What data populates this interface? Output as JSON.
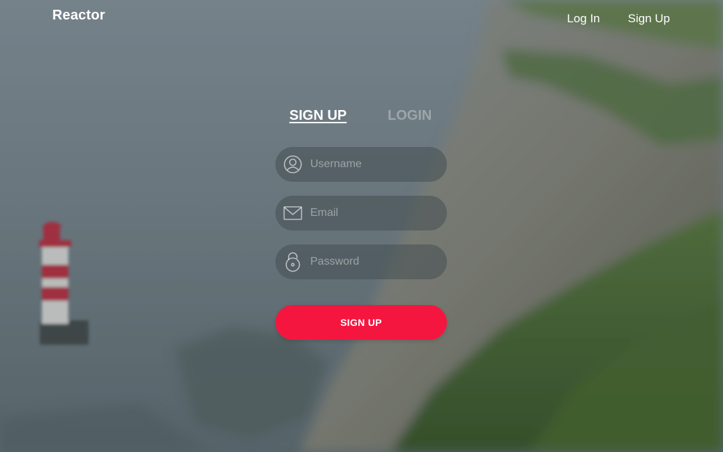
{
  "brand": {
    "name": "Reactor"
  },
  "nav": {
    "login_label": "Log In",
    "signup_label": "Sign Up"
  },
  "tabs": [
    {
      "label": "SIGN UP",
      "active": true
    },
    {
      "label": "LOGIN",
      "active": false
    }
  ],
  "form": {
    "username": {
      "placeholder": "Username",
      "value": "",
      "icon": "user-icon"
    },
    "email": {
      "placeholder": "Email",
      "value": "",
      "icon": "envelope-icon"
    },
    "password": {
      "placeholder": "Password",
      "value": "",
      "icon": "lock-icon"
    },
    "submit_label": "SIGN UP"
  },
  "colors": {
    "accent": "#f5163f",
    "field_bg": "rgba(70, 78, 84, 0.55)"
  }
}
